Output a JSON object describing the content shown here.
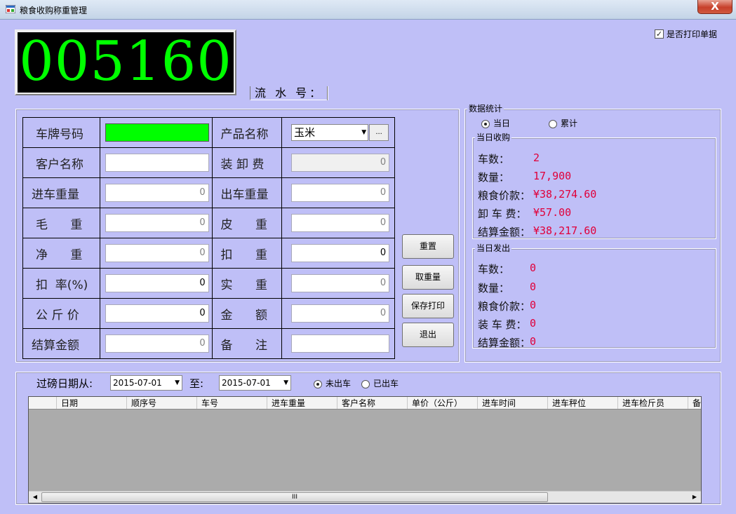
{
  "window": {
    "title": "粮食收购称重管理",
    "close_label": "X"
  },
  "led": {
    "value": "005160"
  },
  "serial": {
    "label": "流 水 号："
  },
  "print_option": {
    "label": "是否打印单据",
    "checked": true
  },
  "form": {
    "plate_label": "车牌号码",
    "product_label": "产品名称",
    "product_value": "玉米",
    "ellipsis_label": "...",
    "customer_label": "客户名称",
    "handling_label": "装 卸 费",
    "handling_value": "0",
    "in_weight_label": "进车重量",
    "in_weight_value": "0",
    "out_weight_label": "出车重量",
    "out_weight_value": "0",
    "gross_label": "毛      重",
    "gross_value": "0",
    "tare_label": "皮      重",
    "tare_value": "0",
    "net_label": "净      重",
    "net_value": "0",
    "deduct_label": "扣      重",
    "deduct_value": "0",
    "deduct_rate_label": "扣  率(%)",
    "deduct_rate_value": "0",
    "actual_label": "实      重",
    "actual_value": "0",
    "unit_price_label": "公 斤 价",
    "unit_price_value": "0",
    "amount_label": "金      额",
    "amount_value": "0",
    "settle_label": "结算金额",
    "settle_value": "0",
    "remark_label": "备      注"
  },
  "buttons": {
    "reset": "重置",
    "get_weight": "取重量",
    "save_print": "保存打印",
    "exit": "退出"
  },
  "stats": {
    "title": "数据统计",
    "today_label": "当日",
    "cumulative_label": "累计",
    "purchase": {
      "title": "当日收购",
      "cars_label": "车数：",
      "cars_value": "2",
      "qty_label": "数量：",
      "qty_value": "17,900",
      "price_label": "粮食价款：",
      "price_value": "¥38,274.60",
      "fee_label": "卸 车 费：",
      "fee_value": "¥57.00",
      "settle_label": "结算金额：",
      "settle_value": "¥38,217.60"
    },
    "shipment": {
      "title": "当日发出",
      "cars_label": "车数：",
      "cars_value": "0",
      "qty_label": "数量：",
      "qty_value": "0",
      "price_label": "粮食价款：",
      "price_value": "0",
      "fee_label": "装 车 费：",
      "fee_value": "0",
      "settle_label": "结算金额：",
      "settle_value": "0"
    }
  },
  "filter": {
    "from_label": "过磅日期从:",
    "from_date": "2015-07-01",
    "to_label": "至:",
    "to_date": "2015-07-01",
    "not_out_label": "未出车",
    "out_label": "已出车"
  },
  "grid": {
    "columns": [
      "日期",
      "顺序号",
      "车号",
      "进车重量",
      "客户名称",
      "单价（公斤）",
      "进车时间",
      "进车秤位",
      "进车检斤员",
      "备"
    ]
  },
  "scrollbar": {
    "thumb_grip": "III"
  }
}
